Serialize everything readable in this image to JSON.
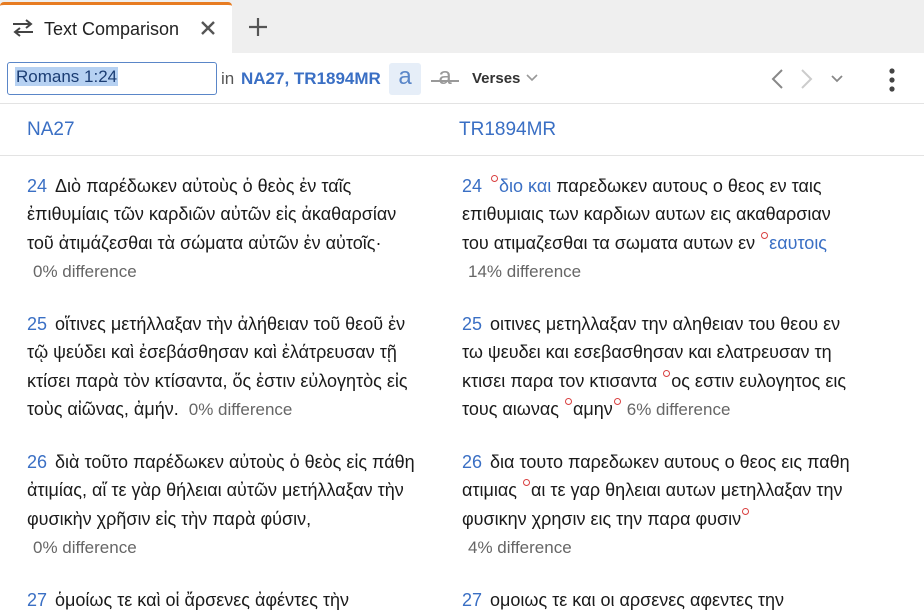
{
  "tab": {
    "title": "Text Comparison"
  },
  "toolbar": {
    "reference": "Romans 1:24",
    "in_label": "in",
    "versions": "NA27, TR1894MR",
    "case_toggle": "a",
    "strike_toggle": "a",
    "verses_label": "Verses"
  },
  "columns": {
    "left": "NA27",
    "right": "TR1894MR"
  },
  "left": {
    "v24": {
      "num": "24",
      "lines": [
        "Διὸ παρέδωκεν αὐτοὺς ὁ θεὸς ἐν ταῖς",
        "ἐπιθυμίαις τῶν καρδιῶν αὐτῶν εἰς ἀκαθαρσίαν",
        "τοῦ ἀτιμάζεσθαι τὰ σώματα αὐτῶν ἐν αὐτοῖς·"
      ],
      "diff": "0% difference"
    },
    "v25": {
      "num": "25",
      "lines": [
        "οἵτινες μετήλλαξαν τὴν ἀλήθειαν τοῦ θεοῦ ἐν",
        "τῷ ψεύδει καὶ ἐσεβάσθησαν καὶ ἐλάτρευσαν τῇ",
        "κτίσει παρὰ τὸν κτίσαντα, ὅς ἐστιν εὐλογητὸς εἰς",
        "τοὺς αἰῶνας, ἀμήν."
      ],
      "diff": "0% difference"
    },
    "v26": {
      "num": "26",
      "lines": [
        "διὰ τοῦτο παρέδωκεν αὐτοὺς ὁ θεὸς εἰς πάθη",
        "ἀτιμίας, αἵ τε γὰρ θήλειαι αὐτῶν μετήλλαξαν τὴν",
        "φυσικὴν χρῆσιν εἰς τὴν παρὰ φύσιν,"
      ],
      "diff": "0% difference"
    },
    "v27": {
      "num": "27",
      "lines": [
        "ὁμοίως τε καὶ οἱ ἄρσενες ἀφέντες τὴν"
      ]
    }
  },
  "right": {
    "v24": {
      "num": "24",
      "changed_a": "διο και",
      "l1_rest": "παρεδωκεν αυτους ο θεος εν ταις",
      "l2": "επιθυμιαις των καρδιων αυτων εις ακαθαρσιαν",
      "l3": "του ατιμαζεσθαι τα σωματα αυτων εν",
      "changed_b": "εαυτοις",
      "diff": "14% difference"
    },
    "v25": {
      "num": "25",
      "l1": "οιτινες μετηλλαξαν την αληθειαν του θεου εν",
      "l2": "τω ψευδει και εσεβασθησαν και ελατρευσαν τη",
      "l3a": "κτισει παρα τον κτισαντα",
      "l3b": "ος εστιν ευλογητος εις",
      "l4a": "τους αιωνας",
      "l4b": "αμην",
      "diff": "6% difference"
    },
    "v26": {
      "num": "26",
      "l1": "δια τουτο παρεδωκεν αυτους ο θεος εις παθη",
      "l2a": "ατιμιας",
      "l2b": "αι τε γαρ θηλειαι αυτων μετηλλαξαν την",
      "l3": "φυσικην χρησιν εις την παρα φυσιν",
      "diff": "4% difference"
    },
    "v27": {
      "num": "27",
      "l1": "ομοιως τε και οι αρσενες αφεντες την"
    }
  },
  "colors": {
    "accent": "#3a6fc4",
    "tab_indicator": "#e77c22",
    "change_marker": "#d94040"
  }
}
